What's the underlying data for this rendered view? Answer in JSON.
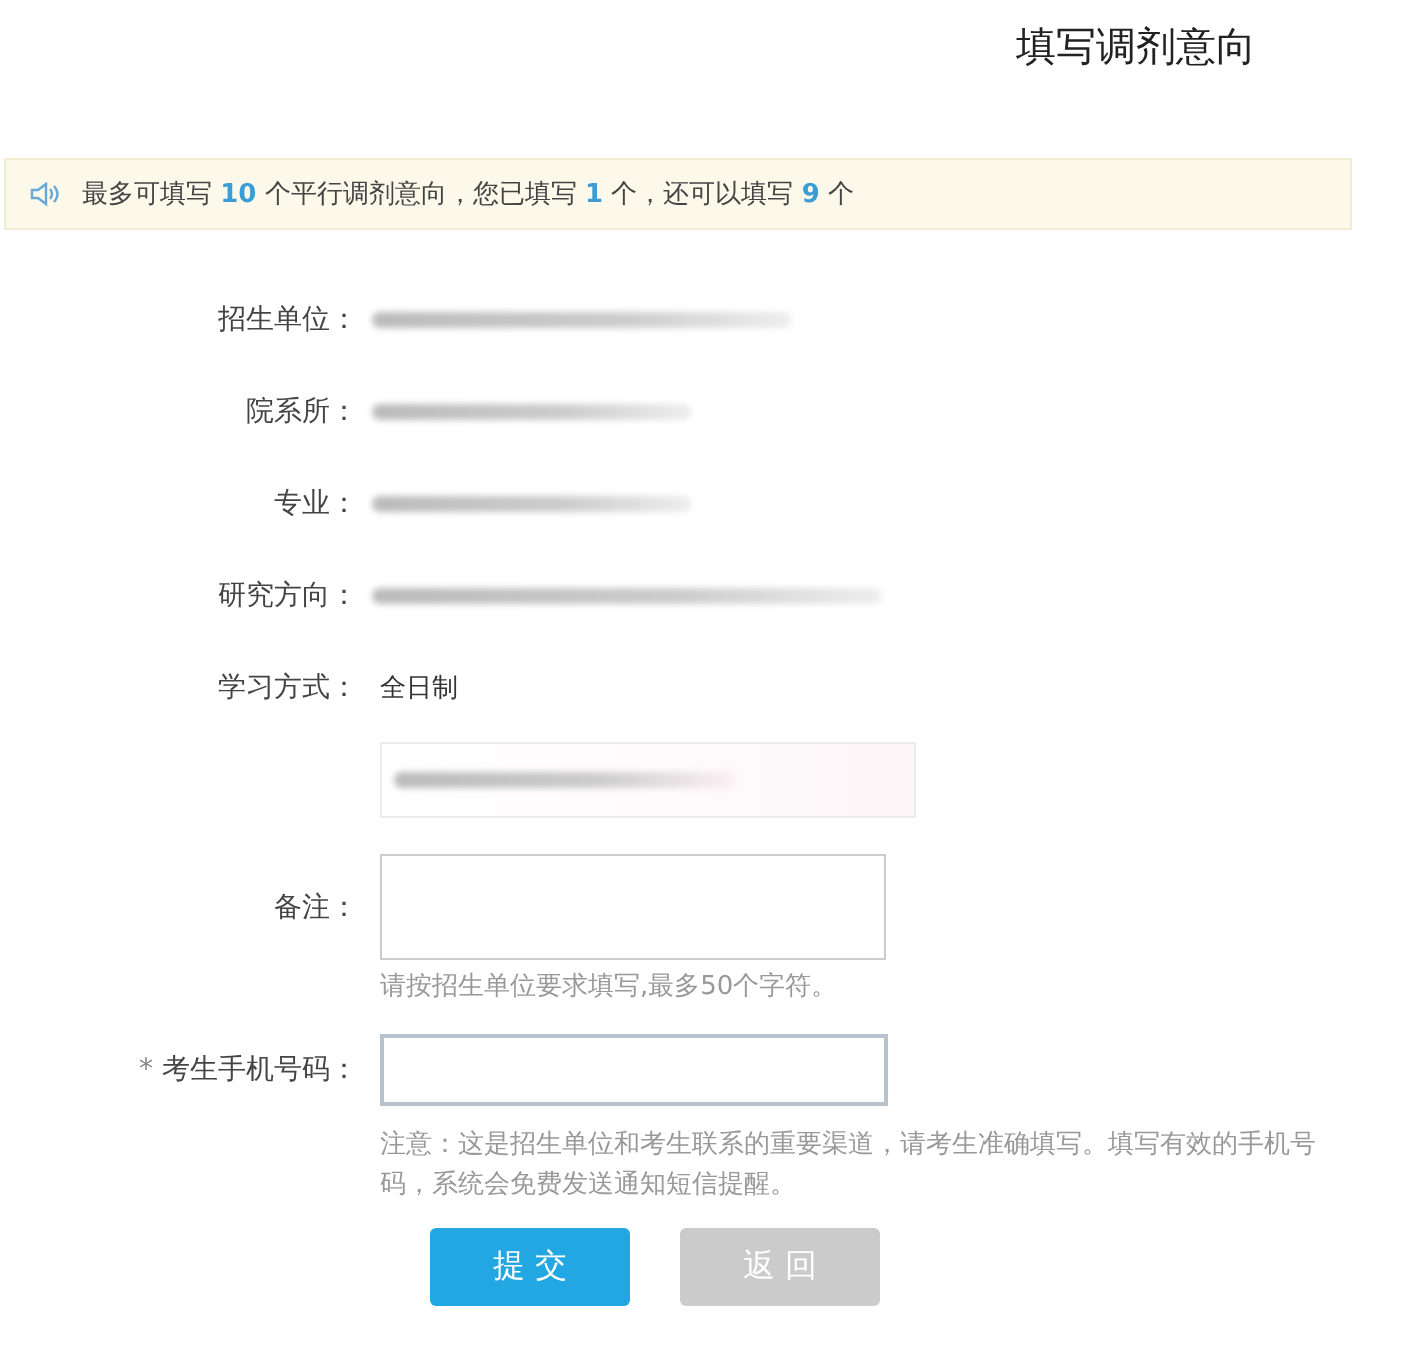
{
  "title": "填写调剂意向",
  "notice": "最多可填写 **10** 个平行调剂意向，您已填写 **1** 个，还可以填写 **9** 个",
  "fields": [
    {
      "label": "招生单位：",
      "kind": "blurred"
    },
    {
      "label": "院系所：",
      "kind": "blurred"
    },
    {
      "label": "专业：",
      "kind": "blurred"
    },
    {
      "label": "研究方向：",
      "kind": "blurred"
    },
    {
      "label": "学习方式：",
      "kind": "text",
      "value": "全日制"
    }
  ],
  "remarks": {
    "label": "备注：",
    "hint": "请按招生单位要求填写,最多50个字符。"
  },
  "phone": {
    "label": "考生手机号码：",
    "marker": "*",
    "note": "注意：这是招生单位和考生联系的重要渠道，请考生准确填写。填写有效的手机号码，系统会免费发送通知短信提醒。"
  },
  "buttons": [
    {
      "label": "提 交",
      "disabled": false
    },
    {
      "label": "返 回",
      "disabled": true
    }
  ]
}
